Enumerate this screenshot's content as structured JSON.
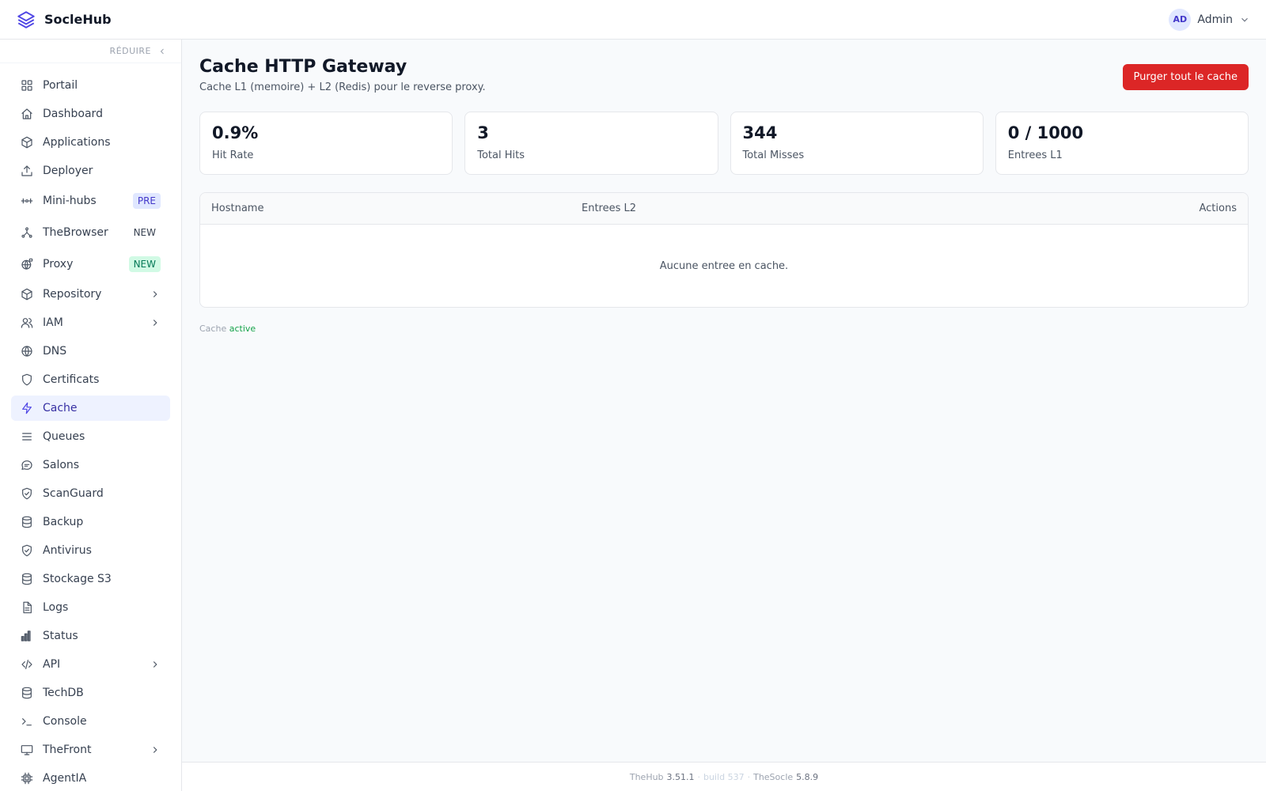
{
  "app": {
    "name": "SocleHub"
  },
  "user": {
    "initials": "AD",
    "name": "Admin"
  },
  "sidebar": {
    "collapse_label": "RÉDUIRE",
    "items": [
      {
        "label": "Portail",
        "icon": "grid-icon"
      },
      {
        "label": "Dashboard",
        "icon": "home-icon"
      },
      {
        "label": "Applications",
        "icon": "package-icon"
      },
      {
        "label": "Deployer",
        "icon": "upload-icon"
      },
      {
        "label": "Mini-hubs",
        "icon": "sliders-icon",
        "badge": "PRE"
      },
      {
        "label": "TheBrowser",
        "icon": "network-icon",
        "badge": "NEW"
      },
      {
        "label": "Proxy",
        "icon": "globe-lock-icon",
        "badge": "NEW"
      },
      {
        "label": "Repository",
        "icon": "box-icon",
        "expandable": true
      },
      {
        "label": "IAM",
        "icon": "users-icon",
        "expandable": true
      },
      {
        "label": "DNS",
        "icon": "globe-icon"
      },
      {
        "label": "Certificats",
        "icon": "shield-icon"
      },
      {
        "label": "Cache",
        "icon": "bolt-icon",
        "active": true
      },
      {
        "label": "Queues",
        "icon": "menu-icon"
      },
      {
        "label": "Salons",
        "icon": "chat-icon"
      },
      {
        "label": "ScanGuard",
        "icon": "shield-check-icon"
      },
      {
        "label": "Backup",
        "icon": "database-icon"
      },
      {
        "label": "Antivirus",
        "icon": "shield-check-icon"
      },
      {
        "label": "Stockage S3",
        "icon": "database-icon"
      },
      {
        "label": "Logs",
        "icon": "file-icon"
      },
      {
        "label": "Status",
        "icon": "bar-chart-icon"
      },
      {
        "label": "API",
        "icon": "code-icon",
        "expandable": true
      },
      {
        "label": "TechDB",
        "icon": "database-icon"
      },
      {
        "label": "Console",
        "icon": "terminal-icon"
      },
      {
        "label": "TheFront",
        "icon": "monitor-icon",
        "expandable": true
      },
      {
        "label": "AgentIA",
        "icon": "cpu-icon"
      }
    ]
  },
  "page": {
    "title": "Cache HTTP Gateway",
    "subtitle": "Cache L1 (memoire) + L2 (Redis) pour le reverse proxy.",
    "purge_button": "Purger tout le cache"
  },
  "stats": [
    {
      "value": "0.9%",
      "label": "Hit Rate"
    },
    {
      "value": "3",
      "label": "Total Hits"
    },
    {
      "value": "344",
      "label": "Total Misses"
    },
    {
      "value": "0 / 1000",
      "label": "Entrees L1"
    }
  ],
  "table": {
    "columns": [
      "Hostname",
      "Entrees L2",
      "Actions"
    ],
    "empty_message": "Aucune entree en cache."
  },
  "cache_status": {
    "prefix": "Cache",
    "state": "active"
  },
  "footer": {
    "thehub_label": "TheHub",
    "thehub_version": "3.51.1",
    "build_label": "build 537",
    "thesocle_label": "TheSocle",
    "thesocle_version": "5.8.9"
  },
  "colors": {
    "accent": "#4f46e5",
    "danger": "#dc2626",
    "success": "#16a34a",
    "active_bg": "#eef2ff"
  }
}
